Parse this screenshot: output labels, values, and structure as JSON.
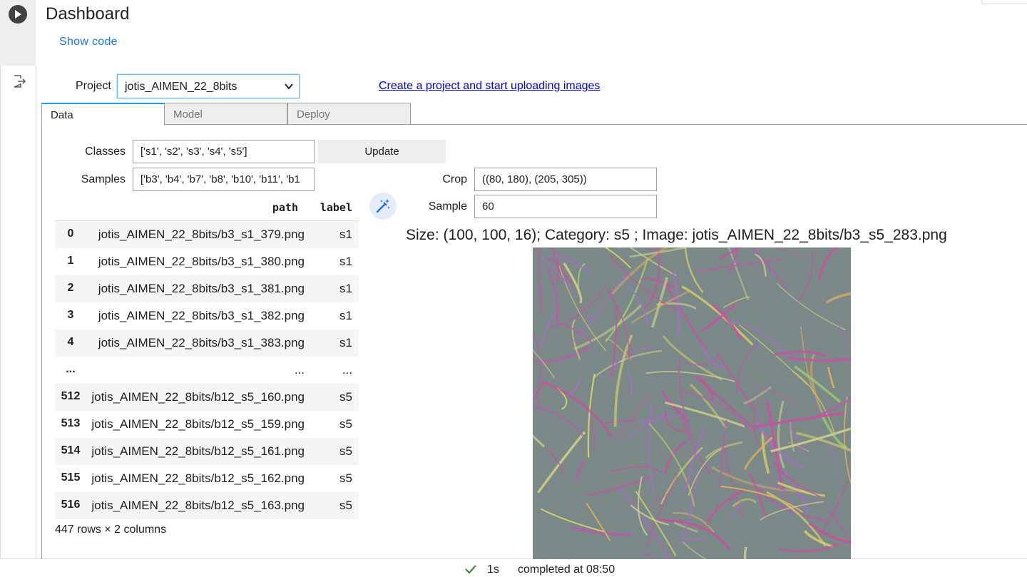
{
  "cell": {
    "title": "Dashboard",
    "show_code_label": "Show code",
    "run_icon": "play-icon",
    "output_icon": "output-redirect-icon"
  },
  "project": {
    "label": "Project",
    "selected": "jotis_AIMEN_22_8bits",
    "create_link": "Create a project and start uploading images"
  },
  "tabs": [
    {
      "label": "Data",
      "active": true
    },
    {
      "label": "Model",
      "active": false
    },
    {
      "label": "Deploy",
      "active": false
    }
  ],
  "data_tab": {
    "classes_label": "Classes",
    "classes_value": "['s1', 's2', 's3', 's4', 's5']",
    "update_label": "Update",
    "samples_label": "Samples",
    "samples_value": "['b3', 'b4', 'b7', 'b8', 'b10', 'b11', 'b1",
    "crop_label": "Crop",
    "crop_value": "((80, 180), (205, 305))",
    "sample_label": "Sample",
    "sample_value": "60",
    "magic_icon": "magic-wand-icon"
  },
  "dataframe": {
    "columns": [
      "path",
      "label"
    ],
    "rows": [
      {
        "index": "0",
        "path": "jotis_AIMEN_22_8bits/b3_s1_379.png",
        "label": "s1"
      },
      {
        "index": "1",
        "path": "jotis_AIMEN_22_8bits/b3_s1_380.png",
        "label": "s1"
      },
      {
        "index": "2",
        "path": "jotis_AIMEN_22_8bits/b3_s1_381.png",
        "label": "s1"
      },
      {
        "index": "3",
        "path": "jotis_AIMEN_22_8bits/b3_s1_382.png",
        "label": "s1"
      },
      {
        "index": "4",
        "path": "jotis_AIMEN_22_8bits/b3_s1_383.png",
        "label": "s1"
      },
      {
        "index": "...",
        "path": "...",
        "label": "..."
      },
      {
        "index": "512",
        "path": "jotis_AIMEN_22_8bits/b12_s5_160.png",
        "label": "s5"
      },
      {
        "index": "513",
        "path": "jotis_AIMEN_22_8bits/b12_s5_159.png",
        "label": "s5"
      },
      {
        "index": "514",
        "path": "jotis_AIMEN_22_8bits/b12_s5_161.png",
        "label": "s5"
      },
      {
        "index": "515",
        "path": "jotis_AIMEN_22_8bits/b12_s5_162.png",
        "label": "s5"
      },
      {
        "index": "516",
        "path": "jotis_AIMEN_22_8bits/b12_s5_163.png",
        "label": "s5"
      }
    ],
    "footer": "447 rows × 2 columns"
  },
  "plot": {
    "title": "Size: (100, 100, 16); Category: s5 ; Image: jotis_AIMEN_22_8bits/b3_s5_283.png"
  },
  "status": {
    "icon": "check-icon",
    "duration": "1s",
    "text": "completed at 08:50",
    "check_color": "#2e7d32"
  }
}
